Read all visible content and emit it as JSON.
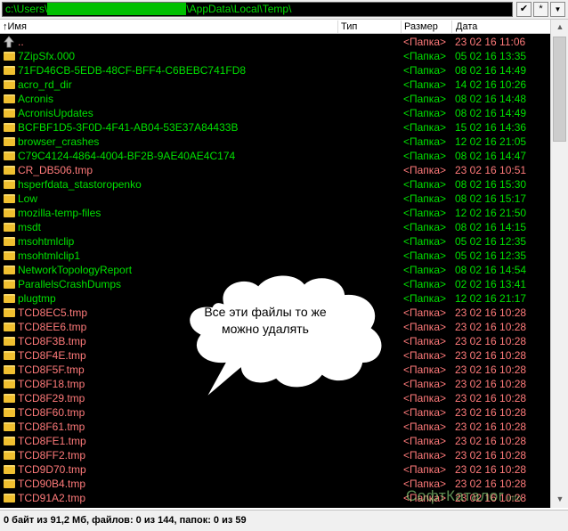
{
  "path": {
    "prefix": "c:\\Users\\",
    "hidden": "xxxxxxxxxxxxxxxxxxxxxxxxxx",
    "suffix": "\\AppData\\Local\\Temp\\"
  },
  "path_buttons": {
    "check": "✔",
    "star": "*",
    "dropdown": "▼"
  },
  "columns": {
    "name": "↑Имя",
    "type": "Тип",
    "size": "Размер",
    "date": "Дата"
  },
  "rows": [
    {
      "name": "..",
      "type": "<Папка>",
      "date": "23 02 16 11:06",
      "color": "pink",
      "icon": "up-arrow-icon"
    },
    {
      "name": "7ZipSfx.000",
      "type": "<Папка>",
      "date": "05 02 16 13:35",
      "color": "green",
      "icon": "folder-icon"
    },
    {
      "name": "71FD46CB-5EDB-48CF-BFF4-C6BEBC741FD8",
      "type": "<Папка>",
      "date": "08 02 16 14:49",
      "color": "green",
      "icon": "folder-icon"
    },
    {
      "name": "acro_rd_dir",
      "type": "<Папка>",
      "date": "14 02 16 10:26",
      "color": "green",
      "icon": "folder-icon"
    },
    {
      "name": "Acronis",
      "type": "<Папка>",
      "date": "08 02 16 14:48",
      "color": "green",
      "icon": "folder-icon"
    },
    {
      "name": "AcronisUpdates",
      "type": "<Папка>",
      "date": "08 02 16 14:49",
      "color": "green",
      "icon": "folder-icon"
    },
    {
      "name": "BCFBF1D5-3F0D-4F41-AB04-53E37A84433B",
      "type": "<Папка>",
      "date": "15 02 16 14:36",
      "color": "green",
      "icon": "folder-icon"
    },
    {
      "name": "browser_crashes",
      "type": "<Папка>",
      "date": "12 02 16 21:05",
      "color": "green",
      "icon": "folder-icon"
    },
    {
      "name": "C79C4124-4864-4004-BF2B-9AE40AE4C174",
      "type": "<Папка>",
      "date": "08 02 16 14:47",
      "color": "green",
      "icon": "folder-icon"
    },
    {
      "name": "CR_DB506.tmp",
      "type": "<Папка>",
      "date": "23 02 16 10:51",
      "color": "pink",
      "icon": "folder-icon"
    },
    {
      "name": "hsperfdata_stastoropenko",
      "type": "<Папка>",
      "date": "08 02 16 15:30",
      "color": "green",
      "icon": "folder-icon"
    },
    {
      "name": "Low",
      "type": "<Папка>",
      "date": "08 02 16 15:17",
      "color": "green",
      "icon": "folder-icon"
    },
    {
      "name": "mozilla-temp-files",
      "type": "<Папка>",
      "date": "12 02 16 21:50",
      "color": "green",
      "icon": "folder-icon"
    },
    {
      "name": "msdt",
      "type": "<Папка>",
      "date": "08 02 16 14:15",
      "color": "green",
      "icon": "folder-icon"
    },
    {
      "name": "msohtmlclip",
      "type": "<Папка>",
      "date": "05 02 16 12:35",
      "color": "green",
      "icon": "folder-icon"
    },
    {
      "name": "msohtmlclip1",
      "type": "<Папка>",
      "date": "05 02 16 12:35",
      "color": "green",
      "icon": "folder-icon"
    },
    {
      "name": "NetworkTopologyReport",
      "type": "<Папка>",
      "date": "08 02 16 14:54",
      "color": "green",
      "icon": "folder-icon"
    },
    {
      "name": "ParallelsCrashDumps",
      "type": "<Папка>",
      "date": "02 02 16 13:41",
      "color": "green",
      "icon": "folder-icon"
    },
    {
      "name": "plugtmp",
      "type": "<Папка>",
      "date": "12 02 16 21:17",
      "color": "green",
      "icon": "folder-icon"
    },
    {
      "name": "TCD8EC5.tmp",
      "type": "<Папка>",
      "date": "23 02 16 10:28",
      "color": "pink",
      "icon": "folder-icon"
    },
    {
      "name": "TCD8EE6.tmp",
      "type": "<Папка>",
      "date": "23 02 16 10:28",
      "color": "pink",
      "icon": "folder-icon"
    },
    {
      "name": "TCD8F3B.tmp",
      "type": "<Папка>",
      "date": "23 02 16 10:28",
      "color": "pink",
      "icon": "folder-icon"
    },
    {
      "name": "TCD8F4E.tmp",
      "type": "<Папка>",
      "date": "23 02 16 10:28",
      "color": "pink",
      "icon": "folder-icon"
    },
    {
      "name": "TCD8F5F.tmp",
      "type": "<Папка>",
      "date": "23 02 16 10:28",
      "color": "pink",
      "icon": "folder-icon"
    },
    {
      "name": "TCD8F18.tmp",
      "type": "<Папка>",
      "date": "23 02 16 10:28",
      "color": "pink",
      "icon": "folder-icon"
    },
    {
      "name": "TCD8F29.tmp",
      "type": "<Папка>",
      "date": "23 02 16 10:28",
      "color": "pink",
      "icon": "folder-icon"
    },
    {
      "name": "TCD8F60.tmp",
      "type": "<Папка>",
      "date": "23 02 16 10:28",
      "color": "pink",
      "icon": "folder-icon"
    },
    {
      "name": "TCD8F61.tmp",
      "type": "<Папка>",
      "date": "23 02 16 10:28",
      "color": "pink",
      "icon": "folder-icon"
    },
    {
      "name": "TCD8FE1.tmp",
      "type": "<Папка>",
      "date": "23 02 16 10:28",
      "color": "pink",
      "icon": "folder-icon"
    },
    {
      "name": "TCD8FF2.tmp",
      "type": "<Папка>",
      "date": "23 02 16 10:28",
      "color": "pink",
      "icon": "folder-icon"
    },
    {
      "name": "TCD9D70.tmp",
      "type": "<Папка>",
      "date": "23 02 16 10:28",
      "color": "pink",
      "icon": "folder-icon"
    },
    {
      "name": "TCD90B4.tmp",
      "type": "<Папка>",
      "date": "23 02 16 10:28",
      "color": "pink",
      "icon": "folder-icon"
    },
    {
      "name": "TCD91A2.tmp",
      "type": "<Папка>",
      "date": "23 02 16 10:28",
      "color": "pink",
      "icon": "folder-icon"
    }
  ],
  "callout": {
    "line1": "Все эти файлы то же",
    "line2": "можно удалять"
  },
  "status": "0 байт из 91,2 Мб, файлов: 0 из 144, папок: 0 из 59",
  "watermark": {
    "main": "СофтКаталог",
    "small": ".info"
  },
  "colors": {
    "list_background": "#000000",
    "folder_text": "#00e000",
    "temp_text": "#ff7a7a",
    "folder_icon": "#f0c030"
  }
}
